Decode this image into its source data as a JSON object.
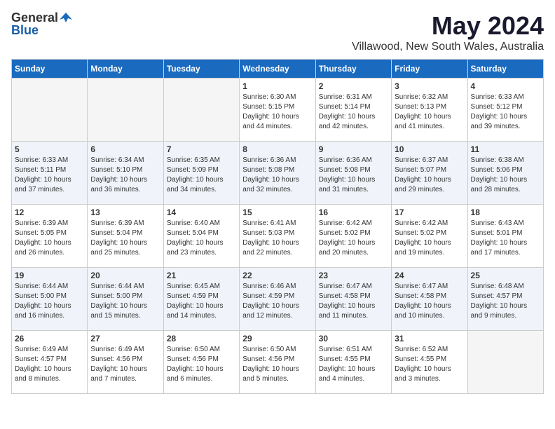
{
  "header": {
    "logo_general": "General",
    "logo_blue": "Blue",
    "month": "May 2024",
    "location": "Villawood, New South Wales, Australia"
  },
  "weekdays": [
    "Sunday",
    "Monday",
    "Tuesday",
    "Wednesday",
    "Thursday",
    "Friday",
    "Saturday"
  ],
  "weeks": [
    [
      {
        "day": "",
        "empty": true
      },
      {
        "day": "",
        "empty": true
      },
      {
        "day": "",
        "empty": true
      },
      {
        "day": "1",
        "sunrise": "6:30 AM",
        "sunset": "5:15 PM",
        "daylight": "10 hours and 44 minutes."
      },
      {
        "day": "2",
        "sunrise": "6:31 AM",
        "sunset": "5:14 PM",
        "daylight": "10 hours and 42 minutes."
      },
      {
        "day": "3",
        "sunrise": "6:32 AM",
        "sunset": "5:13 PM",
        "daylight": "10 hours and 41 minutes."
      },
      {
        "day": "4",
        "sunrise": "6:33 AM",
        "sunset": "5:12 PM",
        "daylight": "10 hours and 39 minutes."
      }
    ],
    [
      {
        "day": "5",
        "sunrise": "6:33 AM",
        "sunset": "5:11 PM",
        "daylight": "10 hours and 37 minutes."
      },
      {
        "day": "6",
        "sunrise": "6:34 AM",
        "sunset": "5:10 PM",
        "daylight": "10 hours and 36 minutes."
      },
      {
        "day": "7",
        "sunrise": "6:35 AM",
        "sunset": "5:09 PM",
        "daylight": "10 hours and 34 minutes."
      },
      {
        "day": "8",
        "sunrise": "6:36 AM",
        "sunset": "5:08 PM",
        "daylight": "10 hours and 32 minutes."
      },
      {
        "day": "9",
        "sunrise": "6:36 AM",
        "sunset": "5:08 PM",
        "daylight": "10 hours and 31 minutes."
      },
      {
        "day": "10",
        "sunrise": "6:37 AM",
        "sunset": "5:07 PM",
        "daylight": "10 hours and 29 minutes."
      },
      {
        "day": "11",
        "sunrise": "6:38 AM",
        "sunset": "5:06 PM",
        "daylight": "10 hours and 28 minutes."
      }
    ],
    [
      {
        "day": "12",
        "sunrise": "6:39 AM",
        "sunset": "5:05 PM",
        "daylight": "10 hours and 26 minutes."
      },
      {
        "day": "13",
        "sunrise": "6:39 AM",
        "sunset": "5:04 PM",
        "daylight": "10 hours and 25 minutes."
      },
      {
        "day": "14",
        "sunrise": "6:40 AM",
        "sunset": "5:04 PM",
        "daylight": "10 hours and 23 minutes."
      },
      {
        "day": "15",
        "sunrise": "6:41 AM",
        "sunset": "5:03 PM",
        "daylight": "10 hours and 22 minutes."
      },
      {
        "day": "16",
        "sunrise": "6:42 AM",
        "sunset": "5:02 PM",
        "daylight": "10 hours and 20 minutes."
      },
      {
        "day": "17",
        "sunrise": "6:42 AM",
        "sunset": "5:02 PM",
        "daylight": "10 hours and 19 minutes."
      },
      {
        "day": "18",
        "sunrise": "6:43 AM",
        "sunset": "5:01 PM",
        "daylight": "10 hours and 17 minutes."
      }
    ],
    [
      {
        "day": "19",
        "sunrise": "6:44 AM",
        "sunset": "5:00 PM",
        "daylight": "10 hours and 16 minutes."
      },
      {
        "day": "20",
        "sunrise": "6:44 AM",
        "sunset": "5:00 PM",
        "daylight": "10 hours and 15 minutes."
      },
      {
        "day": "21",
        "sunrise": "6:45 AM",
        "sunset": "4:59 PM",
        "daylight": "10 hours and 14 minutes."
      },
      {
        "day": "22",
        "sunrise": "6:46 AM",
        "sunset": "4:59 PM",
        "daylight": "10 hours and 12 minutes."
      },
      {
        "day": "23",
        "sunrise": "6:47 AM",
        "sunset": "4:58 PM",
        "daylight": "10 hours and 11 minutes."
      },
      {
        "day": "24",
        "sunrise": "6:47 AM",
        "sunset": "4:58 PM",
        "daylight": "10 hours and 10 minutes."
      },
      {
        "day": "25",
        "sunrise": "6:48 AM",
        "sunset": "4:57 PM",
        "daylight": "10 hours and 9 minutes."
      }
    ],
    [
      {
        "day": "26",
        "sunrise": "6:49 AM",
        "sunset": "4:57 PM",
        "daylight": "10 hours and 8 minutes."
      },
      {
        "day": "27",
        "sunrise": "6:49 AM",
        "sunset": "4:56 PM",
        "daylight": "10 hours and 7 minutes."
      },
      {
        "day": "28",
        "sunrise": "6:50 AM",
        "sunset": "4:56 PM",
        "daylight": "10 hours and 6 minutes."
      },
      {
        "day": "29",
        "sunrise": "6:50 AM",
        "sunset": "4:56 PM",
        "daylight": "10 hours and 5 minutes."
      },
      {
        "day": "30",
        "sunrise": "6:51 AM",
        "sunset": "4:55 PM",
        "daylight": "10 hours and 4 minutes."
      },
      {
        "day": "31",
        "sunrise": "6:52 AM",
        "sunset": "4:55 PM",
        "daylight": "10 hours and 3 minutes."
      },
      {
        "day": "",
        "empty": true
      }
    ]
  ]
}
